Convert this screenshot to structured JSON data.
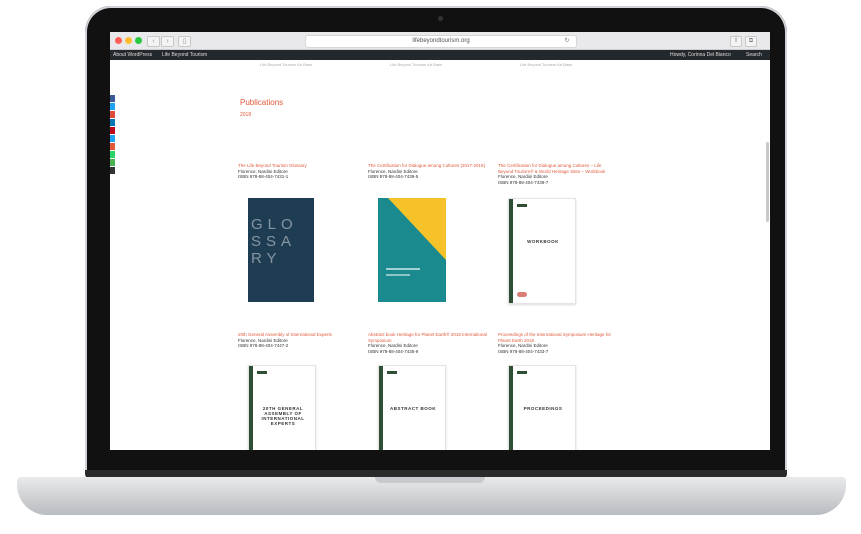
{
  "browser": {
    "url": "lifebeyondtourism.org",
    "back_icon": "‹",
    "forward_icon": "›",
    "sidebar_icon": "▯",
    "reload_icon": "↻",
    "share_icon": "⇧",
    "tabs_icon": "⧉",
    "colors": {
      "close": "#ff5f57",
      "minimize": "#febc2e",
      "maximize": "#28c840"
    }
  },
  "admin_bar": {
    "about": "About WordPress",
    "site": "Life Beyond Tourism",
    "greeting": "Howdy, Corinna Del Bianco",
    "search": "Search"
  },
  "share_rail": {
    "colors": [
      "#3b5998",
      "#1da1f2",
      "#dd4b39",
      "#0077b5",
      "#bd081c",
      "#1da1f2",
      "#e05a3a",
      "#25d366",
      "#4caf50",
      "#333333"
    ]
  },
  "page": {
    "faint_labels": [
      "Life Beyond Tourism Art Base",
      "Life Beyond Tourism Art Base",
      "Life Beyond Tourism Art Base"
    ],
    "heading": "Publications",
    "year": "2018",
    "publications": [
      {
        "title": "The Life Beyond Tourism Glossary",
        "publisher": "Florence, Nardini Editore",
        "isbn": "ISBN 978-88-404-7431-1",
        "cover": {
          "style": "dark-blue",
          "text": "GLOSSARY"
        }
      },
      {
        "title": "The Certification for Dialogue among Cultures (2017-2018)",
        "publisher": "Florence, Nardini Editore",
        "isbn": "ISBN 978-88-404-7439-5",
        "cover": {
          "style": "teal-yellow",
          "text": ""
        }
      },
      {
        "title": "The Certification for Dialogue among Cultures – Life Beyond Tourism® & World Heritage Sites – Workbook",
        "publisher": "Florence, Nardini Editore",
        "isbn": "ISBN 978-88-404-7439-7",
        "cover": {
          "style": "white",
          "text": "WORKBOOK"
        }
      },
      {
        "title": "20th General Assembly of International Experts",
        "publisher": "Florence, Nardini Editore",
        "isbn": "ISBN 978-88-404-7447-2",
        "cover": {
          "style": "white",
          "text": "20TH GENERAL ASSEMBLY OF INTERNATIONAL EXPERTS"
        }
      },
      {
        "title": "Abstract book Heritage for Planet Earth® 2018 International Symposium",
        "publisher": "Florence, Nardini Editore",
        "isbn": "ISBN 978-88-404-7435-9",
        "cover": {
          "style": "white",
          "text": "ABSTRACT BOOK"
        }
      },
      {
        "title": "Proceedings of the International Symposium Heritage for Planet Earth 2018",
        "publisher": "Florence, Nardini Editore",
        "isbn": "ISBN 978-88-404-7433-7",
        "cover": {
          "style": "white",
          "text": "PROCEEDINGS"
        }
      }
    ]
  }
}
